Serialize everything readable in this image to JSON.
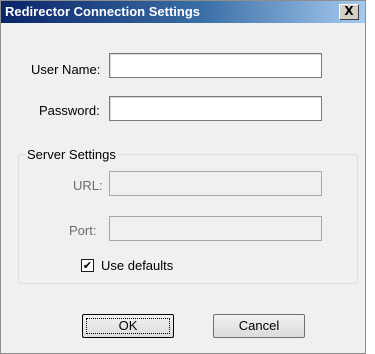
{
  "window": {
    "title": "Redirector Connection Settings",
    "close_label": "X"
  },
  "form": {
    "username_label": "User Name:",
    "username_value": "",
    "password_label": "Password:",
    "password_value": ""
  },
  "server_settings": {
    "group_label": "Server Settings",
    "url_label": "URL:",
    "url_value": "",
    "port_label": "Port:",
    "port_value": "",
    "use_defaults_label": "Use defaults",
    "use_defaults_checked": true,
    "check_mark": "✔"
  },
  "buttons": {
    "ok_label": "OK",
    "cancel_label": "Cancel"
  }
}
